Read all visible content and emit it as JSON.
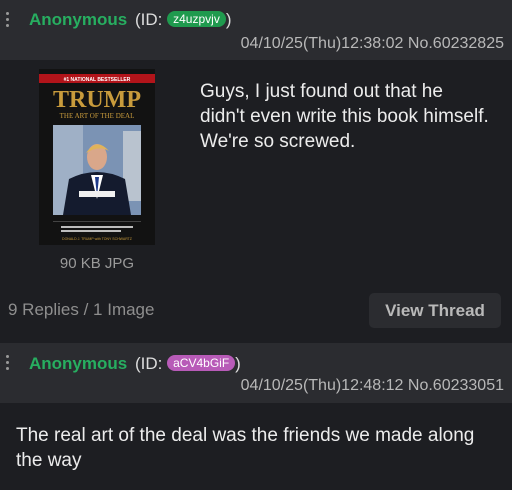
{
  "thread": {
    "op": {
      "name": "Anonymous",
      "id_prefix": "(ID:",
      "id": "z4uzpvjv",
      "id_suffix": ")",
      "id_color": "#1f9a4e",
      "datetime": "04/10/25(Thu)12:38:02",
      "post_no": "No.60232825",
      "text": "Guys, I just found out that he didn't even write this book himself. We're so screwed.",
      "image": {
        "icon": "book-cover-image",
        "bestseller": "#1 NATIONAL BESTSELLER",
        "book_title": "TRUMP",
        "book_subtitle": "THE ART OF THE DEAL",
        "authors": "DONALD J. TRUMP with TONY SCHWARTZ"
      },
      "file_info": "90 KB JPG"
    },
    "summary": "9 Replies / 1 Image",
    "view_thread_label": "View Thread"
  },
  "reply": {
    "name": "Anonymous",
    "id_prefix": "(ID:",
    "id": "aCV4bGiF",
    "id_suffix": ")",
    "id_color": "#b85bb8",
    "datetime": "04/10/25(Thu)12:48:12",
    "post_no": "No.60233051",
    "text": "The real art of the deal was the friends we made along the way"
  },
  "colors": {
    "name": "#27ae60",
    "background": "#1d1e22",
    "header": "#2b2c30"
  }
}
